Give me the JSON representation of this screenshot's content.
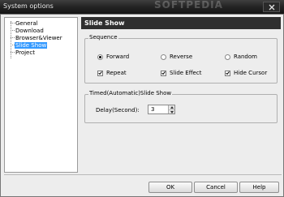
{
  "window": {
    "title": "System options",
    "watermark": "SOFTPEDIA"
  },
  "nav": {
    "items": [
      {
        "label": "General"
      },
      {
        "label": "Download"
      },
      {
        "label": "Browser&Viewer"
      },
      {
        "label": "Slide Show",
        "selected": true
      },
      {
        "label": "Project"
      }
    ]
  },
  "panel": {
    "title": "Slide Show"
  },
  "sequence": {
    "legend": "Sequence",
    "order_options": [
      {
        "label": "Forward",
        "checked": true
      },
      {
        "label": "Reverse",
        "checked": false
      },
      {
        "label": "Random",
        "checked": false
      }
    ],
    "checkboxes": [
      {
        "label": "Repeat",
        "checked": true
      },
      {
        "label": "Slide Effect",
        "checked": true
      },
      {
        "label": "Hide Cursor",
        "checked": true
      }
    ]
  },
  "timed": {
    "legend": "Timed(Automatic)Slide Show",
    "delay_label": "Delay(Second):",
    "delay_value": "3"
  },
  "buttons": {
    "ok": "OK",
    "cancel": "Cancel",
    "help": "Help"
  },
  "colors": {
    "titlebar": "#262626",
    "panel_header": "#2f2f2f",
    "selection": "#3399ff",
    "dialog_bg": "#ededed"
  }
}
